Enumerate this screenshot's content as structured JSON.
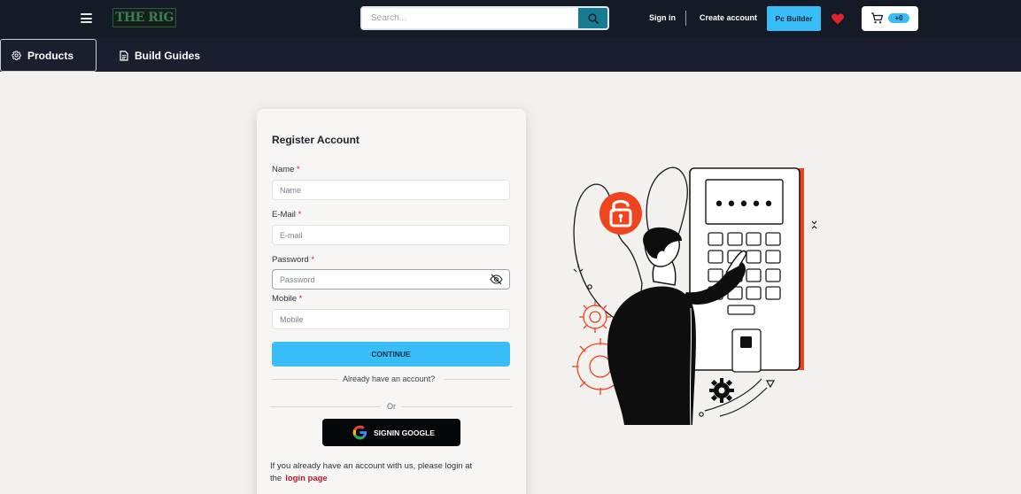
{
  "header": {
    "logo_text": "THE RIG",
    "search_placeholder": "Search...",
    "sign_in": "Sign in",
    "create_account": "Create account",
    "pc_builder": "Pc Builder",
    "cart_count": "+0",
    "colors": {
      "bar": "#141a26",
      "accent": "#38bdf8",
      "search_button": "#177a93",
      "heart": "#e0242b"
    }
  },
  "subnav": {
    "tabs": [
      {
        "label": "Products",
        "icon": "gear-icon"
      },
      {
        "label": "Build Guides",
        "icon": "document-icon"
      }
    ]
  },
  "form": {
    "title": "Register Account",
    "fields": [
      {
        "label": "Name",
        "required": "*",
        "placeholder": "Name",
        "value": ""
      },
      {
        "label": "E-Mail",
        "required": "*",
        "placeholder": "E-mail",
        "value": ""
      },
      {
        "label": "Password",
        "required": "*",
        "placeholder": "Password",
        "value": ""
      },
      {
        "label": "Mobile",
        "required": "*",
        "placeholder": "Mobile",
        "value": ""
      }
    ],
    "continue_label": "CONTINUE",
    "already_text": "Already have an account?",
    "or_text": "Or",
    "google_label": "SIGNIN GOOGLE",
    "login_note": "If you already have an account with us, please login at the",
    "login_link": "login page"
  },
  "illustration": {
    "keypad_display": "•••••",
    "lock_color": "#f0441f"
  }
}
